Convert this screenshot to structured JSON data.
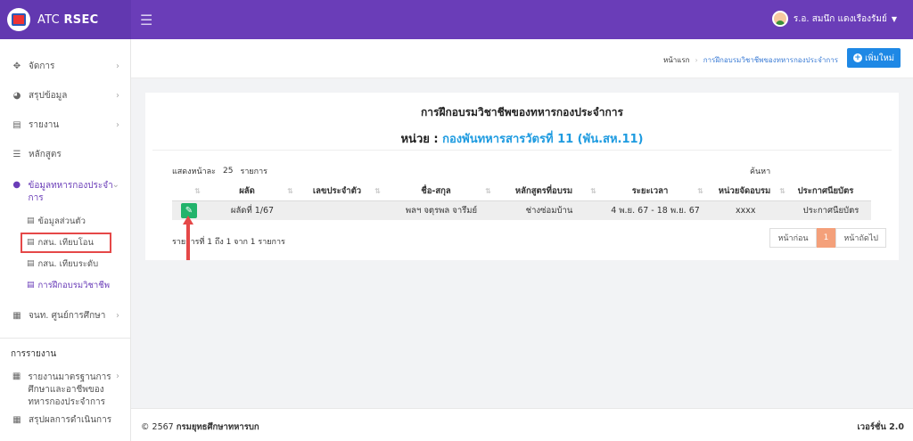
{
  "app": {
    "name_prefix": "ATC",
    "name_bold": "RSEC"
  },
  "header": {
    "menu_icon": "hamburger-icon",
    "user_name": "ร.อ. สมนึก แดงเรืองรัมย์"
  },
  "sidebar": {
    "items": [
      {
        "label": "จัดการ",
        "icon": "move-icon"
      },
      {
        "label": "สรุปข้อมูล",
        "icon": "pie-chart-icon"
      },
      {
        "label": "รายงาน",
        "icon": "bar-chart-icon"
      },
      {
        "label": "หลักสูตร",
        "icon": "list-icon"
      },
      {
        "label": "ข้อมูลทหารกองประจำการ",
        "icon": "users-icon"
      }
    ],
    "sub_items": [
      {
        "label": "ข้อมูลส่วนตัว"
      },
      {
        "label": "กสน. เทียบโอน"
      },
      {
        "label": "กสน. เทียบระดับ"
      },
      {
        "label": "การฝึกอบรมวิชาชีพ"
      }
    ],
    "item_education": {
      "label": "จนท. ศูนย์การศึกษา"
    },
    "report_header": "การรายงาน",
    "report_items": [
      {
        "label": "รายงานมาตรฐานการศึกษาและอาชีพของทหารกองประจำการ"
      },
      {
        "label": "สรุปผลการดำเนินการ"
      }
    ]
  },
  "breadcrumb": {
    "home": "หน้าแรก",
    "current": "การฝึกอบรมวิชาชีพของทหารกองประจำการ"
  },
  "add_button": {
    "label": "เพิ่มใหม่"
  },
  "card": {
    "title": "การฝึกอบรมวิชาชีพของทหารกองประจำการ",
    "unit_label": "หน่วย :",
    "unit_value": "กองพันทหารสารวัตรที่ 11 (พัน.สห.11)",
    "length_prefix": "แสดงหน้าละ",
    "length_value": "25",
    "length_suffix": "รายการ",
    "search_label": "ค้นหา"
  },
  "table": {
    "columns": [
      "",
      "ผลัด",
      "เลขประจำตัว",
      "ชื่อ-สกุล",
      "หลักสูตรที่อบรม",
      "ระยะเวลา",
      "หน่วยจัดอบรม",
      "ประกาศนียบัตร"
    ],
    "rows": [
      {
        "round": "ผลัดที่ 1/67",
        "id": "",
        "name": "พลฯ จตุรพล จารึมย์",
        "course": "ช่างซ่อมบ้าน",
        "period": "4 พ.ย. 67 - 18 พ.ย. 67",
        "org": "xxxx",
        "cert": "ประกาศนียบัตร"
      }
    ],
    "info": "รายการที่ 1 ถึง 1 จาก 1 รายการ"
  },
  "pagination": {
    "prev": "หน้าก่อน",
    "current": "1",
    "next": "หน้าถัดไป"
  },
  "footer": {
    "copyright": "© 2567",
    "org": "กรมยุทธศึกษาทหารบก",
    "version": "เวอร์ชั่น 2.0"
  },
  "colors": {
    "header": "#6a3db8",
    "accent_blue": "#1e88e5",
    "edit_green": "#21b36b",
    "highlight_red": "#e54848"
  }
}
